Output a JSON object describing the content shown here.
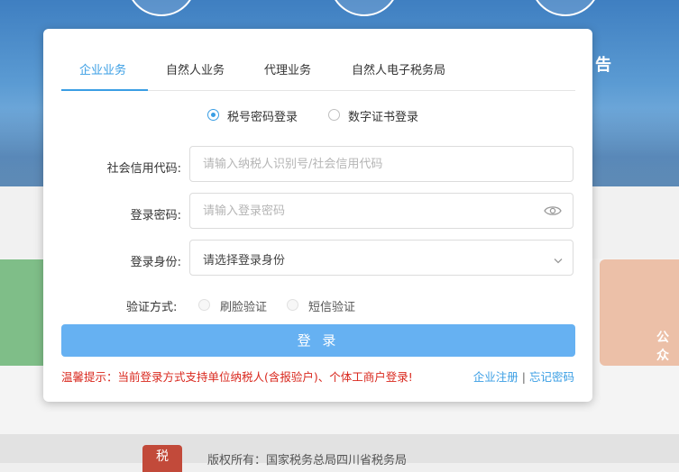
{
  "tabs": [
    {
      "label": "企业业务",
      "active": true
    },
    {
      "label": "自然人业务",
      "active": false
    },
    {
      "label": "代理业务",
      "active": false
    },
    {
      "label": "自然人电子税务局",
      "active": false
    }
  ],
  "login_method": {
    "options": [
      {
        "label": "税号密码登录",
        "selected": true
      },
      {
        "label": "数字证书登录",
        "selected": false
      }
    ]
  },
  "form": {
    "credit_code": {
      "label": "社会信用代码:",
      "placeholder": "请输入纳税人识别号/社会信用代码",
      "value": ""
    },
    "password": {
      "label": "登录密码:",
      "placeholder": "请输入登录密码",
      "value": ""
    },
    "identity": {
      "label": "登录身份:",
      "value": "请选择登录身份"
    },
    "verify": {
      "label": "验证方式:",
      "options": [
        {
          "label": "刷脸验证",
          "enabled": false
        },
        {
          "label": "短信验证",
          "enabled": false
        }
      ]
    }
  },
  "login_button": "登 录",
  "tip": "温馨提示：当前登录方式支持单位纳税人(含报验户)、个体工商户登录!",
  "links": {
    "register": "企业注册",
    "separator": "|",
    "forgot": "忘记密码"
  },
  "background": {
    "side_text": "告",
    "orange_card_text": "公众",
    "footer_logo_char": "税",
    "footer_text": "版权所有：国家税务总局四川省税务局"
  },
  "colors": {
    "accent": "#3a9ee4",
    "button": "#66b1f2",
    "warning": "#d9281e"
  },
  "icons": {
    "password_toggle": "eye-icon",
    "identity_dropdown": "chevron-down-icon"
  }
}
